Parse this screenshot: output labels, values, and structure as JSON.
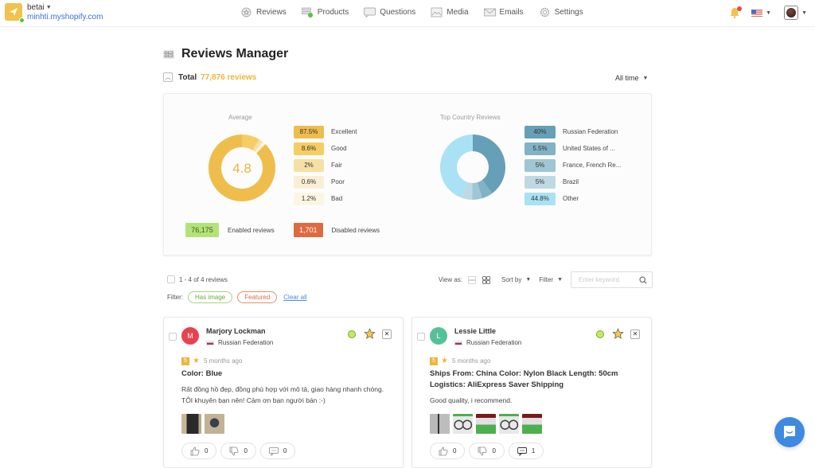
{
  "store": {
    "name": "betai",
    "url": "minhti.myshopify.com"
  },
  "nav": [
    {
      "label": "Reviews",
      "icon": "star-circle-icon"
    },
    {
      "label": "Products",
      "icon": "products-icon"
    },
    {
      "label": "Questions",
      "icon": "question-bubble-icon"
    },
    {
      "label": "Media",
      "icon": "image-icon"
    },
    {
      "label": "Emails",
      "icon": "envelope-icon"
    },
    {
      "label": "Settings",
      "icon": "gear-icon"
    }
  ],
  "header": {
    "title": "Reviews Manager",
    "total_label": "Total",
    "total_value": "77,876 reviews",
    "period": "All time"
  },
  "chart_data": [
    {
      "type": "pie",
      "title": "Average",
      "center_label": "4.8",
      "categories": [
        "Excellent",
        "Good",
        "Fair",
        "Poor",
        "Bad"
      ],
      "values": [
        87.5,
        8.6,
        2,
        0.6,
        1.2
      ],
      "value_labels": [
        "87.5%",
        "8.6%",
        "2%",
        "0.6%",
        "1.2%"
      ],
      "colors": [
        "#efbd4c",
        "#f5cd63",
        "#f6e0a4",
        "#faefd4",
        "#fcf5e1"
      ]
    },
    {
      "type": "pie",
      "title": "Top Country Reviews",
      "categories": [
        "Russian Federation",
        "United States of ...",
        "France, French Re...",
        "Brazil",
        "Other"
      ],
      "values": [
        40,
        5.5,
        5,
        5,
        44.8
      ],
      "value_labels": [
        "40%",
        "5.5%",
        "5%",
        "5%",
        "44.8%"
      ],
      "colors": [
        "#66a0b8",
        "#80b3c6",
        "#9fc6d4",
        "#bed9e3",
        "#a9e2f5"
      ]
    }
  ],
  "counts": {
    "enabled": {
      "value": "76,175",
      "label": "Enabled reviews",
      "color": "#b3e377"
    },
    "disabled": {
      "value": "1,701",
      "label": "Disabled reviews",
      "color": "#de6b40"
    }
  },
  "list": {
    "count_text": "1 - 4 of 4 reviews",
    "filter_label": "Filter:",
    "filters": [
      "Has image",
      "Featured"
    ],
    "clear_all": "Clear all",
    "view_as": "View as:",
    "sort_by": "Sort by",
    "filter_dd": "Filter",
    "search_placeholder": "Enter keyword"
  },
  "reviews": [
    {
      "initial": "M",
      "avatar_color": "#e8424f",
      "name": "Marjory Lockman",
      "country": "Russian Federation",
      "score": "5",
      "time": "5 months ago",
      "title": "Color: Blue",
      "body": "Rất đồng hồ đẹp, đồng phù hợp với mô tả, giao hàng nhanh chóng. TÔI khuyên bạn nên! Cảm ơn bạn người bán :-)",
      "thumbs": 2,
      "likes": "0",
      "dislikes": "0",
      "comments": "0"
    },
    {
      "initial": "L",
      "avatar_color": "#55c19a",
      "name": "Lessie Little",
      "country": "Russian Federation",
      "score": "5",
      "time": "5 months ago",
      "title": "Ships From: China Color: Nylon Black Length: 50cm Logistics: AliExpress Saver Shipping",
      "body": "Good quality, i recommend.",
      "thumbs": 5,
      "likes": "0",
      "dislikes": "0",
      "comments": "1"
    }
  ]
}
